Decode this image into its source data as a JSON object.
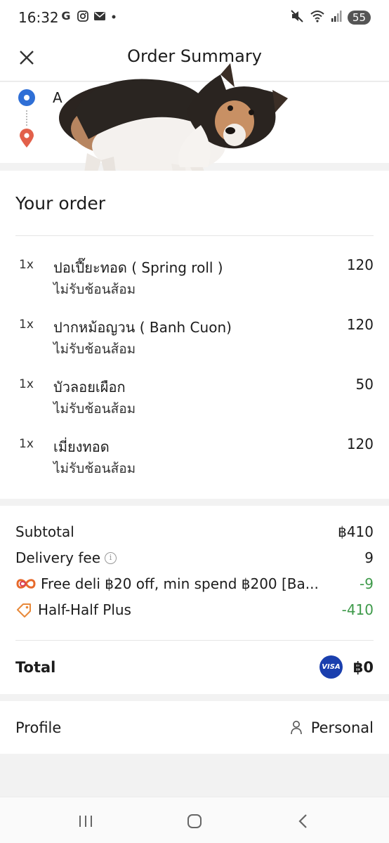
{
  "status_bar": {
    "time": "16:32",
    "battery": "55"
  },
  "header": {
    "title": "Order Summary"
  },
  "route": {
    "origin_label": "A"
  },
  "order": {
    "title": "Your order",
    "items": [
      {
        "qty": "1x",
        "name": "ปอเปี๊ยะทอด ( Spring roll )",
        "note": "ไม่รับช้อนส้อม",
        "price": "120"
      },
      {
        "qty": "1x",
        "name": "ปากหม้อญวน ( Banh Cuon)",
        "note": "ไม่รับช้อนส้อม",
        "price": "120"
      },
      {
        "qty": "1x",
        "name": "บัวลอยเผือก",
        "note": "ไม่รับช้อนส้อม",
        "price": "50"
      },
      {
        "qty": "1x",
        "name": "เมี่ยงทอด",
        "note": "ไม่รับช้อนส้อม",
        "price": "120"
      }
    ]
  },
  "summary": {
    "subtotal_label": "Subtotal",
    "subtotal_value": "฿410",
    "delivery_label": "Delivery fee",
    "delivery_value": "9",
    "promo1_label": "Free deli ฿20 off, min spend ฿200 [Ba...",
    "promo1_value": "-9",
    "promo2_label": "Half-Half Plus",
    "promo2_value": "-410",
    "total_label": "Total",
    "payment_brand": "VISA",
    "total_value": "฿0"
  },
  "profile": {
    "label": "Profile",
    "value": "Personal"
  },
  "colors": {
    "accent_green": "#3e9a4a",
    "origin_pin": "#2f6fd6",
    "destination_pin": "#e2604a",
    "visa_blue": "#1a3fae"
  }
}
